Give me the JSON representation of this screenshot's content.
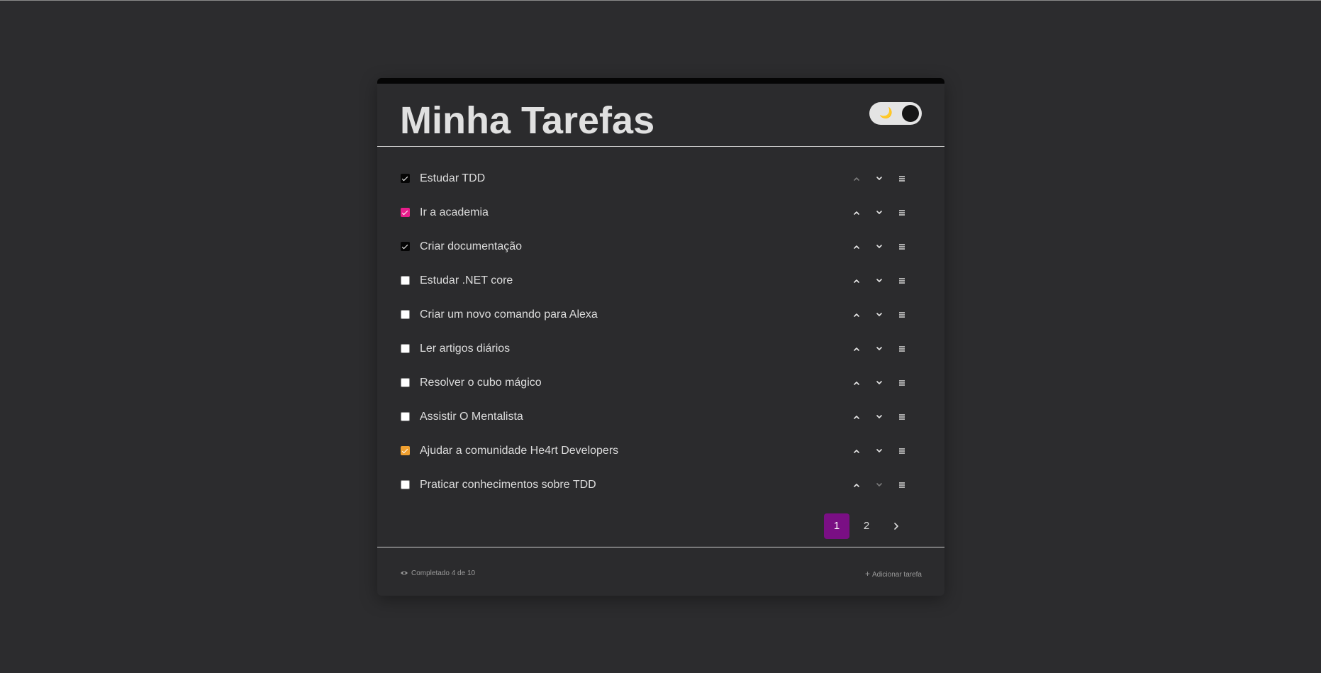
{
  "app": {
    "title": "Minha Tarefas",
    "theme_toggle_icon": "moon-icon",
    "colors": {
      "background": "#2c2c2e",
      "card": "#2b2b2d",
      "active_page": "#7a0f84"
    }
  },
  "tasks": [
    {
      "label": "Estudar TDD",
      "checked": true,
      "color": "#050505",
      "can_move_up": false,
      "can_move_down": true
    },
    {
      "label": "Ir a academia",
      "checked": true,
      "color": "#e91e8c",
      "can_move_up": true,
      "can_move_down": true
    },
    {
      "label": "Criar documentação",
      "checked": true,
      "color": "#050505",
      "can_move_up": true,
      "can_move_down": true
    },
    {
      "label": "Estudar .NET core",
      "checked": false,
      "color": "#ffffff",
      "can_move_up": true,
      "can_move_down": true
    },
    {
      "label": "Criar um novo comando para Alexa",
      "checked": false,
      "color": "#ffffff",
      "can_move_up": true,
      "can_move_down": true
    },
    {
      "label": "Ler artigos diários",
      "checked": false,
      "color": "#ffffff",
      "can_move_up": true,
      "can_move_down": true
    },
    {
      "label": "Resolver o cubo mágico",
      "checked": false,
      "color": "#ffffff",
      "can_move_up": true,
      "can_move_down": true
    },
    {
      "label": "Assistir O Mentalista",
      "checked": false,
      "color": "#ffffff",
      "can_move_up": true,
      "can_move_down": true
    },
    {
      "label": "Ajudar a comunidade He4rt Developers",
      "checked": true,
      "color": "#f0a030",
      "can_move_up": true,
      "can_move_down": true
    },
    {
      "label": "Praticar conhecimentos sobre TDD",
      "checked": false,
      "color": "#ffffff",
      "can_move_up": true,
      "can_move_down": false
    }
  ],
  "pagination": {
    "pages": [
      "1",
      "2"
    ],
    "current": "1",
    "next_icon": "chevron-right-icon"
  },
  "footer": {
    "completed_text": "Completado 4 de 10",
    "add_task_text": "Adicionar tarefa"
  }
}
